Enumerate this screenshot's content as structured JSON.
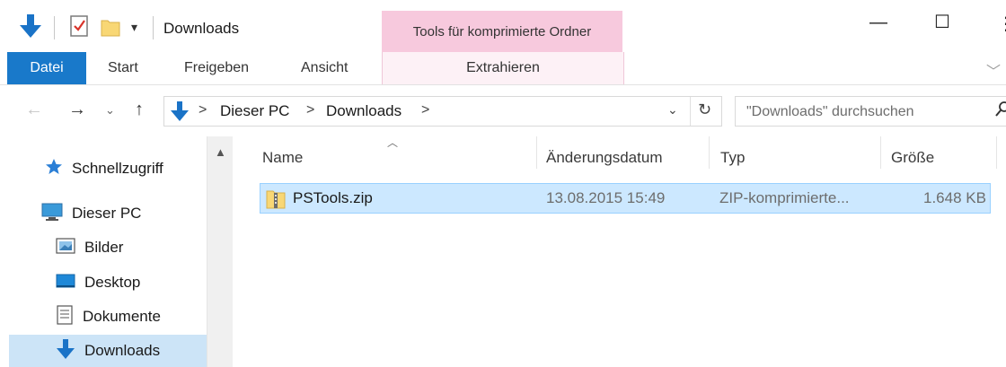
{
  "titlebar": {
    "title": "Downloads",
    "contextual_group": "Tools für komprimierte Ordner",
    "minimize_glyph": "—",
    "maximize_glyph": "☐",
    "close_glyph": "⋮"
  },
  "ribbon": {
    "tabs": [
      {
        "label": "Datei",
        "active": true
      },
      {
        "label": "Start"
      },
      {
        "label": "Freigeben"
      },
      {
        "label": "Ansicht"
      },
      {
        "label": "Extrahieren",
        "contextual": true
      }
    ],
    "collapse_glyph": "﹀"
  },
  "addressbar": {
    "breadcrumb": [
      "Dieser PC",
      "Downloads"
    ],
    "separator": ">",
    "search_placeholder": "\"Downloads\" durchsuchen"
  },
  "navpane": {
    "items": [
      {
        "label": "Schnellzugriff",
        "icon": "star-icon"
      },
      {
        "label": "Dieser PC",
        "icon": "computer-icon"
      },
      {
        "label": "Bilder",
        "icon": "pictures-icon"
      },
      {
        "label": "Desktop",
        "icon": "desktop-icon"
      },
      {
        "label": "Dokumente",
        "icon": "documents-icon"
      },
      {
        "label": "Downloads",
        "icon": "download-arrow-icon",
        "selected": true
      }
    ]
  },
  "filelist": {
    "columns": [
      "Name",
      "Änderungsdatum",
      "Typ",
      "Größe"
    ],
    "rows": [
      {
        "name": "PSTools.zip",
        "modified": "13.08.2015 15:49",
        "type": "ZIP-komprimierte...",
        "size": "1.648 KB",
        "icon": "zip-folder-icon",
        "selected": true
      }
    ]
  },
  "colors": {
    "accent": "#1979ca",
    "contextual": "#f7c9dd",
    "selection": "#cce8ff"
  }
}
